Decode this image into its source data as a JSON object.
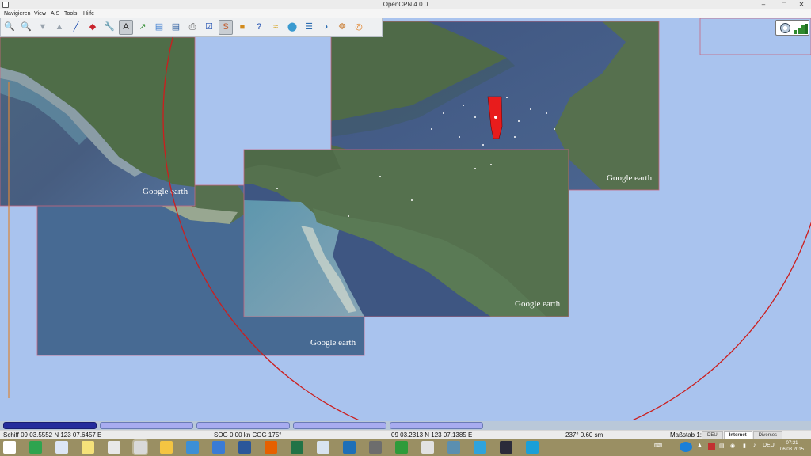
{
  "window": {
    "title": "OpenCPN 4.0.0",
    "min_glyph": "–",
    "max_glyph": "□",
    "close_glyph": "✕"
  },
  "menu": [
    "Navigieren",
    "View",
    "AIS",
    "Tools",
    "Hilfe"
  ],
  "toolbar": {
    "tools": [
      {
        "name": "zoom-in-icon",
        "glyph": "🔍",
        "color": "#2b6fc2"
      },
      {
        "name": "zoom-out-icon",
        "glyph": "🔍",
        "color": "#2b6fc2"
      },
      {
        "name": "scale-in-icon",
        "glyph": "▼",
        "color": "#9aa4ae"
      },
      {
        "name": "scale-out-icon",
        "glyph": "▲",
        "color": "#9aa4ae"
      },
      {
        "name": "route-icon",
        "glyph": "╱",
        "color": "#1f4fb0"
      },
      {
        "name": "mark-icon",
        "glyph": "◆",
        "color": "#c8232c"
      },
      {
        "name": "settings-icon",
        "glyph": "🔧",
        "color": "#555555"
      },
      {
        "name": "text-icon",
        "glyph": "A",
        "color": "#2a2a2a"
      },
      {
        "name": "auto-follow-icon",
        "glyph": "↗",
        "color": "#2d8a2d"
      },
      {
        "name": "chart-icon",
        "glyph": "▤",
        "color": "#3c7dd0"
      },
      {
        "name": "chart-toggle-icon",
        "glyph": "▤",
        "color": "#2a5c9f"
      },
      {
        "name": "print-icon",
        "glyph": "⎙",
        "color": "#555555"
      },
      {
        "name": "route-manager-icon",
        "glyph": "☑",
        "color": "#1f4fb0"
      },
      {
        "name": "track-icon",
        "glyph": "S",
        "color": "#c25a2a"
      },
      {
        "name": "color-scheme-icon",
        "glyph": "■",
        "color": "#d28a1a"
      },
      {
        "name": "help-icon",
        "glyph": "?",
        "color": "#1f4fb0"
      },
      {
        "name": "tides-icon",
        "glyph": "≈",
        "color": "#d8a72a"
      },
      {
        "name": "currents-icon",
        "glyph": "⬤",
        "color": "#3a9ad0"
      },
      {
        "name": "grib-icon",
        "glyph": "☰",
        "color": "#2a6bb0"
      },
      {
        "name": "weather-icon",
        "glyph": "◑",
        "color": "#2a6bb0"
      },
      {
        "name": "chart-downloader-icon",
        "glyph": "☸",
        "color": "#c8782a"
      },
      {
        "name": "mob-icon",
        "glyph": "◎",
        "color": "#e07a1a"
      }
    ],
    "active_tools": [
      7,
      13
    ]
  },
  "chart_overlay": {
    "watermark": "Google earth",
    "colors": {
      "water_deep": "#3e507a",
      "water_mid": "#4a6a90",
      "land": "#53704f",
      "chart_border": "#c7677f",
      "range_ring": "#cc1e1e",
      "vessel": "#e81c1c"
    }
  },
  "quilt": {
    "segments": 5,
    "active_index": 0
  },
  "statusbar": {
    "ship_position": "Schiff  09 03.5552 N    123 07.6457 E",
    "sog_cog": "SOG 0.00 kn  COG 175°",
    "cursor_position": "09 03.2313 N    123 07.1385 E",
    "cursor_bearing_range": "237°   0.60 sm",
    "scale": "Maßstab 1:1",
    "tabs": [
      "DEU",
      "Internet",
      "Diverses"
    ],
    "active_tab": 1
  },
  "taskbar": {
    "icons": [
      {
        "name": "windows-start-icon",
        "color": "#ffffff"
      },
      {
        "name": "calc-icon",
        "color": "#2ea44f"
      },
      {
        "name": "notepad-icon",
        "color": "#dde6f5"
      },
      {
        "name": "sticky-notes-icon",
        "color": "#f5e27a"
      },
      {
        "name": "file-icon",
        "color": "#e8e8e8"
      },
      {
        "name": "opencpn-task-icon",
        "color": "#d9d9d9"
      },
      {
        "name": "explorer-icon",
        "color": "#f4c542"
      },
      {
        "name": "webcam-icon",
        "color": "#3c8fd6"
      },
      {
        "name": "maxthon-icon",
        "color": "#3a7bd5"
      },
      {
        "name": "word-icon",
        "color": "#2b579a"
      },
      {
        "name": "firefox-icon",
        "color": "#e66000"
      },
      {
        "name": "excel-icon",
        "color": "#217346"
      },
      {
        "name": "network-icon",
        "color": "#d8e3ef"
      },
      {
        "name": "outlook-icon",
        "color": "#1d6fb8"
      },
      {
        "name": "tablet-icon",
        "color": "#6d6d6d"
      },
      {
        "name": "stocks-icon",
        "color": "#2d9b3a"
      },
      {
        "name": "audio-icon",
        "color": "#e2e2e2"
      },
      {
        "name": "photo-icon",
        "color": "#5b8fb0"
      },
      {
        "name": "psd-icon",
        "color": "#2fa3dd"
      },
      {
        "name": "lightroom-icon",
        "color": "#2b2b3a"
      },
      {
        "name": "edge-app-icon",
        "color": "#1a9fd8"
      }
    ],
    "tray": {
      "language": "DEU"
    },
    "clock": {
      "time": "07:21",
      "date": "06.03.2015"
    }
  }
}
